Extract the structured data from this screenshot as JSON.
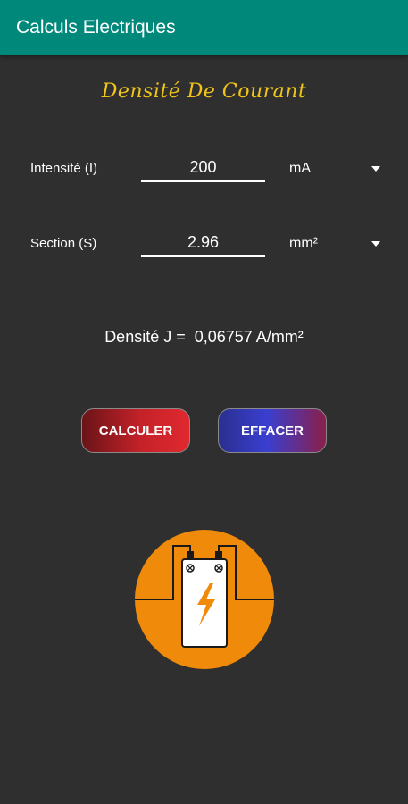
{
  "appbar": {
    "title": "Calculs Electriques"
  },
  "heading": "Densité De Courant",
  "rows": {
    "intensity": {
      "label": "Intensité (I)",
      "value": "200",
      "unit": "mA"
    },
    "section": {
      "label": "Section (S)",
      "value": "2.96",
      "unit": "mm²"
    }
  },
  "result": {
    "text": "Densité J =  0,06757 A/mm²"
  },
  "buttons": {
    "calculate": "CALCULER",
    "clear": "EFFACER"
  },
  "colors": {
    "appbar": "#00897b",
    "background": "#2f2f2f",
    "heading": "#f0c419",
    "logo_circle": "#f08a0b"
  },
  "icons": {
    "logo": "battery-lightning-icon",
    "dropdown": "caret-down-icon"
  }
}
